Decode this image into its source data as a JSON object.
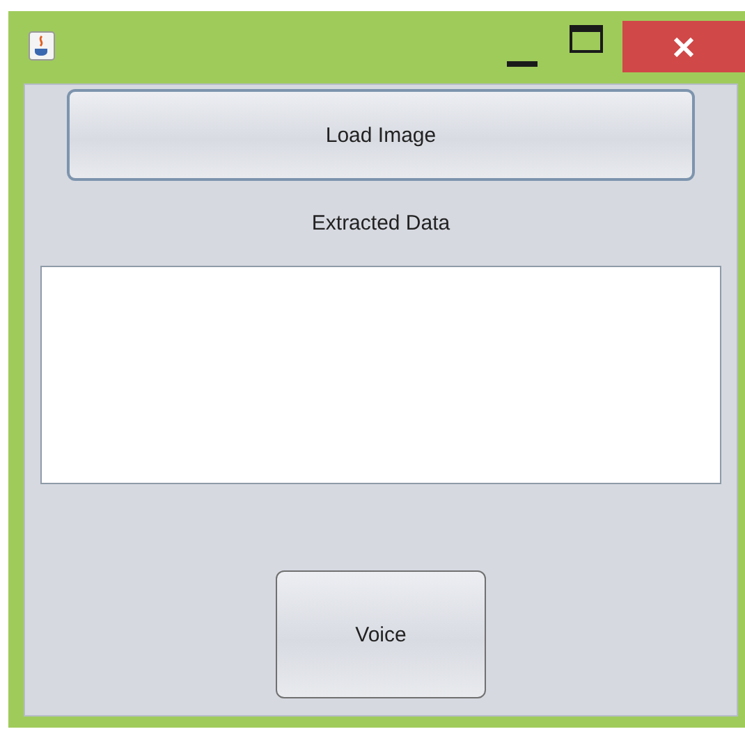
{
  "buttons": [
    {
      "label": "Load Image",
      "focused": true
    }
  ],
  "label": "Extracted Data",
  "voice_button": {
    "label": "Voice",
    "focused": false
  }
}
